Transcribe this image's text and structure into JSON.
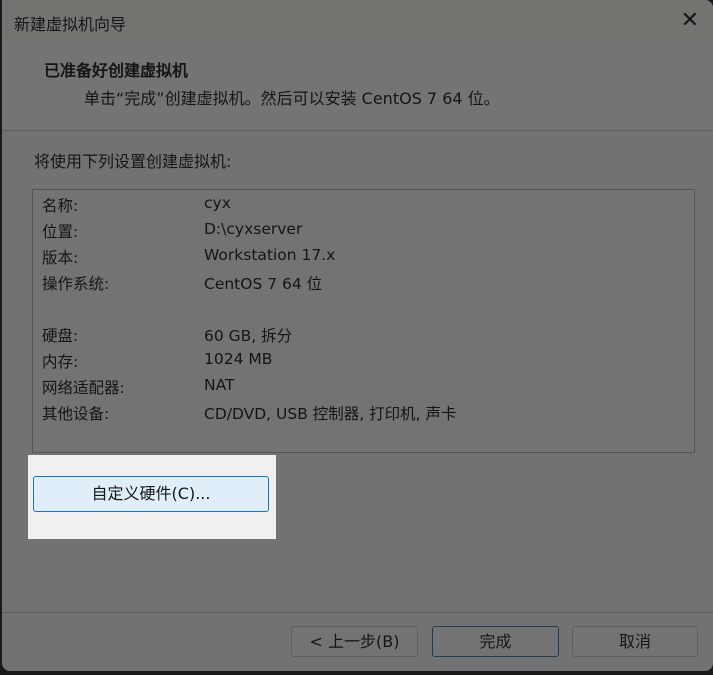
{
  "window": {
    "title": "新建虚拟机向导",
    "close_icon": "close-icon"
  },
  "header": {
    "title": "已准备好创建虚拟机",
    "subtitle": "单击“完成”创建虚拟机。然后可以安装 CentOS 7 64 位。"
  },
  "intro": "将使用下列设置创建虚拟机:",
  "settings": [
    {
      "label": "名称:",
      "value": "cyx"
    },
    {
      "label": "位置:",
      "value": "D:\\cyxserver"
    },
    {
      "label": "版本:",
      "value": "Workstation 17.x"
    },
    {
      "label": "操作系统:",
      "value": "CentOS 7 64 位"
    },
    {
      "label": "硬盘:",
      "value": "60 GB, 拆分"
    },
    {
      "label": "内存:",
      "value": "1024 MB"
    },
    {
      "label": "网络适配器:",
      "value": "NAT"
    },
    {
      "label": "其他设备:",
      "value": "CD/DVD, USB 控制器, 打印机, 声卡"
    }
  ],
  "buttons": {
    "customize": "自定义硬件(C)...",
    "back": "< 上一步(B)",
    "finish": "完成",
    "cancel": "取消"
  }
}
